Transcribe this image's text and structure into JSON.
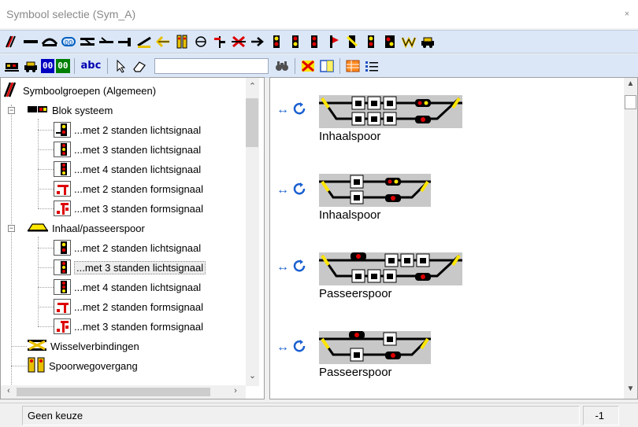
{
  "window": {
    "title": "Symbool selectie (Sym_A)",
    "close_glyph": "×"
  },
  "toolbar1": {
    "icons": [
      "track-red-icon",
      "straight-track-icon",
      "curve-track-icon",
      "loop-track-icon",
      "double-crossover-icon",
      "turnout-left-icon",
      "buffer-stop-icon",
      "diagonal-track-icon",
      "arrow-left-yellow-icon",
      "level-crossing-icon",
      "circle-minus-icon",
      "semaphore-icon",
      "cross-red-icon",
      "arrow-right-icon",
      "signal-2-icon",
      "signal-3-icon",
      "signal-4-icon",
      "signal-flag-icon",
      "signal-yellow-icon",
      "signal-5-icon",
      "signal-6-icon",
      "crown-icon",
      "car-icon"
    ]
  },
  "toolbar2": {
    "counter_a": "00",
    "counter_b": "00",
    "text_label": "abc",
    "search_value": ""
  },
  "tree": {
    "root": {
      "label": "Symboolgroepen (Algemeen)"
    },
    "groups": [
      {
        "label": "Blok systeem",
        "items": [
          {
            "label": "...met 2 standen lichtsignaal"
          },
          {
            "label": "...met 3 standen lichtsignaal"
          },
          {
            "label": "...met 4 standen lichtsignaal"
          },
          {
            "label": "...met 2 standen formsignaal"
          },
          {
            "label": "...met 3 standen formsignaal"
          }
        ]
      },
      {
        "label": "Inhaal/passeerspoor",
        "items": [
          {
            "label": "...met 2 standen lichtsignaal"
          },
          {
            "label": "...met 3 standen lichtsignaal",
            "selected": true
          },
          {
            "label": "...met 4 standen lichtsignaal"
          },
          {
            "label": "...met 2 standen formsignaal"
          },
          {
            "label": "...met 3 standen formsignaal"
          }
        ]
      },
      {
        "label": "Wisselverbindingen"
      },
      {
        "label": "Spoorwegovergang"
      }
    ]
  },
  "symbols": [
    {
      "caption": "Inhaalspoor"
    },
    {
      "caption": "Inhaalspoor"
    },
    {
      "caption": "Passeerspoor"
    },
    {
      "caption": "Passeerspoor"
    }
  ],
  "status": {
    "message": "Geen keuze",
    "value": "-1"
  },
  "colors": {
    "toolbar_bg": "#dbe7f7",
    "signal_red": "#e00000",
    "signal_yellow": "#ffe600",
    "track_grey": "#c8c8c8"
  }
}
